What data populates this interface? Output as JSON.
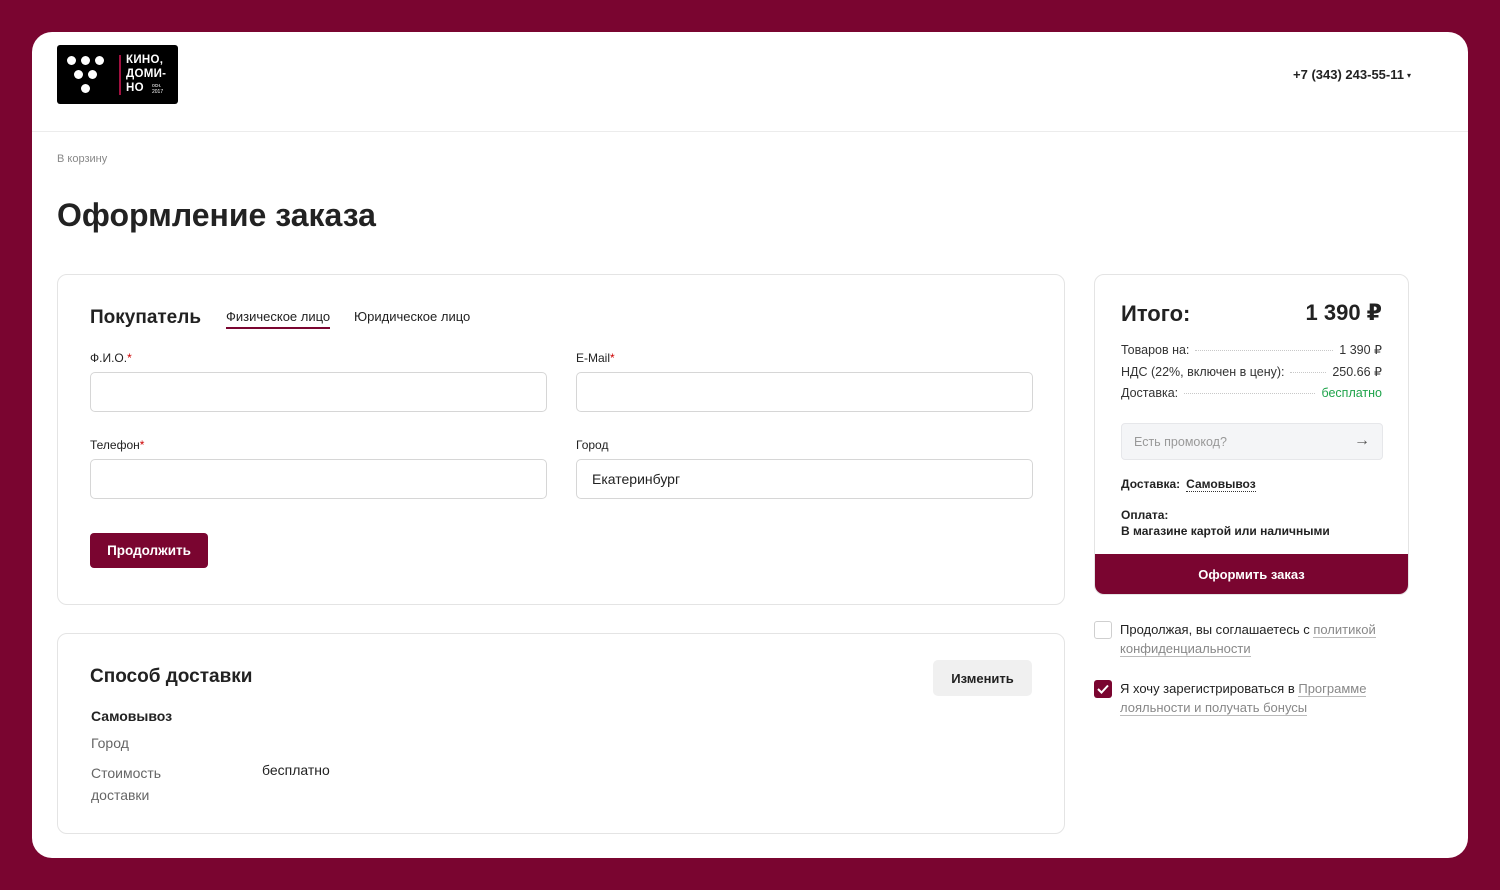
{
  "header": {
    "logo_lines": [
      "КИНО,",
      "ДОМИ-",
      "НО"
    ],
    "logo_est": [
      "осн.",
      "2017"
    ],
    "phone": "+7 (343) 243-55-11"
  },
  "breadcrumb": "В корзину",
  "page_title": "Оформление заказа",
  "buyer": {
    "heading": "Покупатель",
    "tabs": [
      {
        "label": "Физическое лицо",
        "active": true
      },
      {
        "label": "Юридическое лицо",
        "active": false
      }
    ],
    "fields": {
      "name_label": "Ф.И.О.",
      "name_value": "",
      "email_label": "E-Mail",
      "email_value": "",
      "phone_label": "Телефон",
      "phone_value": "",
      "city_label": "Город",
      "city_value": "Екатеринбург"
    },
    "required_mark": "*",
    "continue_label": "Продолжить"
  },
  "delivery": {
    "heading": "Способ доставки",
    "change_label": "Изменить",
    "method": "Самовывоз",
    "city_label": "Город",
    "cost_label": "Стоимость доставки",
    "cost_value": "бесплатно"
  },
  "summary": {
    "title": "Итого:",
    "total": "1 390 ₽",
    "rows": [
      {
        "label": "Товаров на:",
        "value": "1 390 ₽"
      },
      {
        "label": "НДС (22%, включен в цену):",
        "value": "250.66 ₽"
      },
      {
        "label": "Доставка:",
        "value": "бесплатно"
      }
    ],
    "promo_placeholder": "Есть промокод?",
    "shipping_label": "Доставка:",
    "shipping_value": "Самовывоз",
    "payment_label": "Оплата:",
    "payment_value": "В магазине картой или наличными",
    "order_button": "Оформить заказ"
  },
  "consents": {
    "privacy_text": "Продолжая, вы соглашаетесь с ",
    "privacy_link": "политикой конфиденциальности",
    "privacy_checked": false,
    "loyalty_text": "Я хочу зарегистрироваться в ",
    "loyalty_link": "Программе лояльности и получать бонусы",
    "loyalty_checked": true
  },
  "colors": {
    "brand": "#7a0530",
    "free_green": "#1ea34a"
  }
}
